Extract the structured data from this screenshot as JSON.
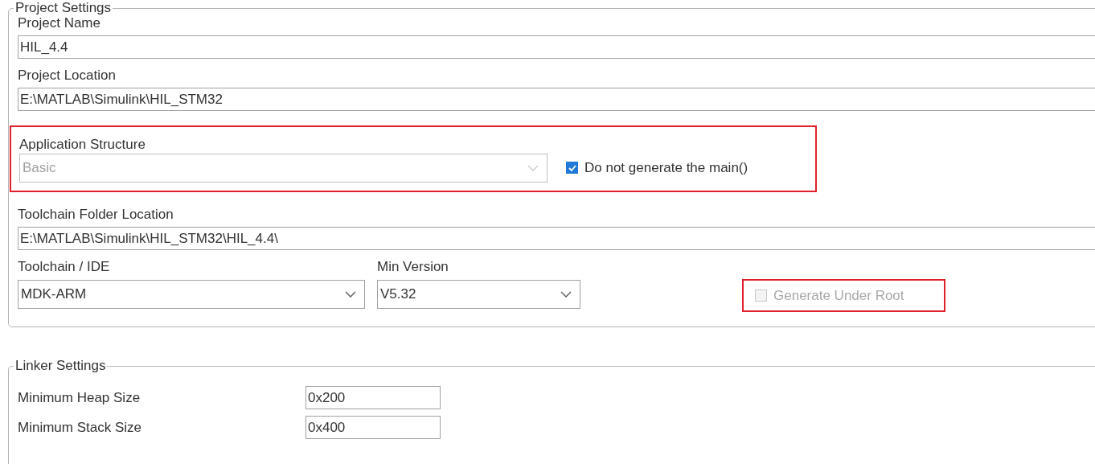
{
  "project_settings": {
    "legend": "Project Settings",
    "project_name": {
      "label": "Project Name",
      "value": "HIL_4.4"
    },
    "project_location": {
      "label": "Project Location",
      "value": "E:\\MATLAB\\Simulink\\HIL_STM32"
    },
    "application_structure": {
      "label": "Application Structure",
      "value": "Basic",
      "disabled": true,
      "highlighted": true,
      "checkbox": {
        "label": "Do not generate the main()",
        "checked": true
      }
    },
    "toolchain_folder": {
      "label": "Toolchain Folder Location",
      "value": "E:\\MATLAB\\Simulink\\HIL_STM32\\HIL_4.4\\"
    },
    "toolchain": {
      "label": "Toolchain / IDE",
      "value": "MDK-ARM"
    },
    "min_version": {
      "label": "Min Version",
      "value": "V5.32"
    },
    "generate_under_root": {
      "label": "Generate Under Root",
      "checked": false,
      "disabled": true,
      "highlighted": true
    }
  },
  "linker_settings": {
    "legend": "Linker Settings",
    "rows": [
      {
        "label": "Minimum Heap Size",
        "value": "0x200"
      },
      {
        "label": "Minimum Stack Size",
        "value": "0x400"
      }
    ]
  }
}
